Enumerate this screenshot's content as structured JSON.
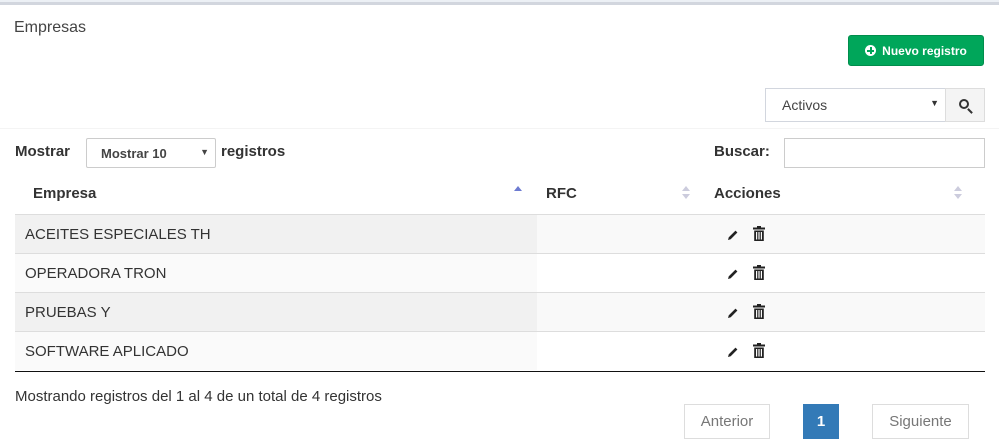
{
  "panel": {
    "title": "Empresas"
  },
  "toolbar": {
    "new_label": "Nuevo registro"
  },
  "filter": {
    "status_value": "Activos"
  },
  "table_controls": {
    "show_label": "Mostrar",
    "length_value": "Mostrar 10",
    "records_label": "registros",
    "search_label": "Buscar:",
    "search_value": ""
  },
  "table": {
    "columns": [
      "Empresa",
      "RFC",
      "Acciones"
    ],
    "rows": [
      {
        "empresa": "ACEITES ESPECIALES TH",
        "rfc": ""
      },
      {
        "empresa": "OPERADORA TRON",
        "rfc": ""
      },
      {
        "empresa": "PRUEBAS Y",
        "rfc": ""
      },
      {
        "empresa": "SOFTWARE APLICADO",
        "rfc": ""
      }
    ]
  },
  "footer": {
    "info": "Mostrando registros del 1 al 4 de un total de 4 registros",
    "prev": "Anterior",
    "page": "1",
    "next": "Siguiente"
  },
  "colors": {
    "success": "#00a65a",
    "primary": "#337ab7"
  },
  "icons": [
    "plus-circle-icon",
    "search-icon",
    "pencil-icon",
    "trash-icon",
    "sort-icon"
  ]
}
